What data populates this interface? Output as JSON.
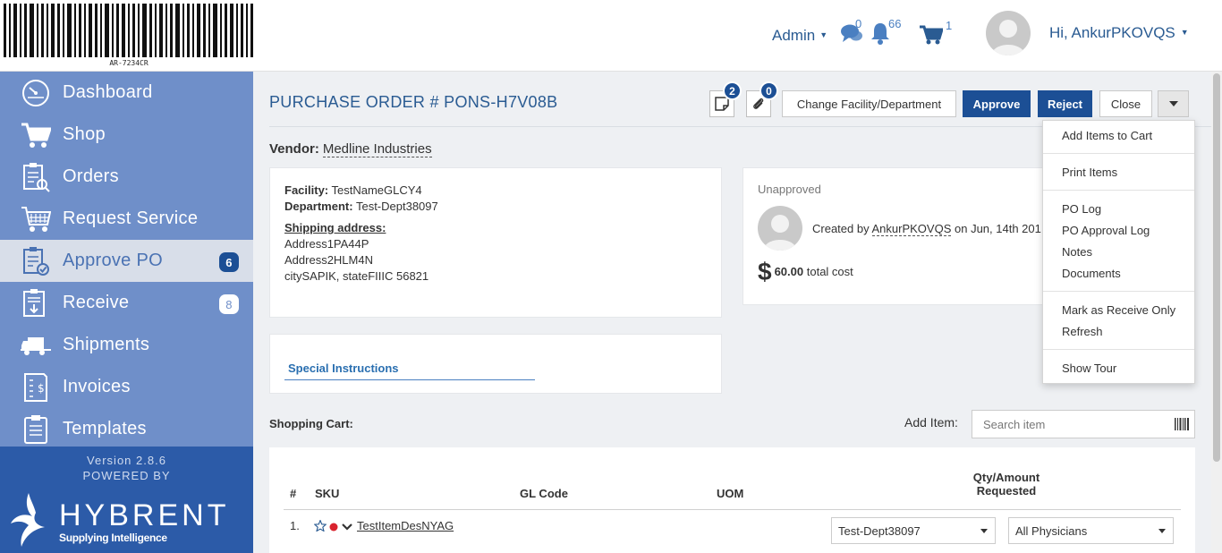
{
  "header": {
    "barcode_text": "AR-7234CR",
    "admin_label": "Admin",
    "messages_count": "0",
    "notifications_count": "66",
    "cart_count": "1",
    "user_greeting": "Hi, AnkurPKOVQS"
  },
  "sidebar": {
    "items": [
      {
        "label": "Dashboard",
        "icon": "dashboard-icon",
        "badge": ""
      },
      {
        "label": "Shop",
        "icon": "cart-icon",
        "badge": ""
      },
      {
        "label": "Orders",
        "icon": "orders-icon",
        "badge": ""
      },
      {
        "label": "Request Service",
        "icon": "request-service-icon",
        "badge": ""
      },
      {
        "label": "Approve PO",
        "icon": "approve-po-icon",
        "badge": "6"
      },
      {
        "label": "Receive",
        "icon": "receive-icon",
        "badge": "8"
      },
      {
        "label": "Shipments",
        "icon": "truck-icon",
        "badge": ""
      },
      {
        "label": "Invoices",
        "icon": "invoice-icon",
        "badge": ""
      },
      {
        "label": "Templates",
        "icon": "template-icon",
        "badge": ""
      }
    ],
    "active_item": "Approve PO",
    "version": "Version 2.8.6",
    "powered_by": "POWERED BY",
    "logo_word": "HYBRENT",
    "logo_tagline": "Supplying Intelligence"
  },
  "po": {
    "title": "PURCHASE ORDER # PONS-H7V08B",
    "notes_count": "2",
    "attachments_count": "0",
    "buttons": {
      "change_facility": "Change Facility/Department",
      "approve": "Approve",
      "reject": "Reject",
      "close": "Close"
    },
    "vendor_label": "Vendor:",
    "vendor_name": "Medline Industries",
    "facility_label": "Facility:",
    "facility": "TestNameGLCY4",
    "department_label": "Department:",
    "department": "Test-Dept38097",
    "shipping_label": "Shipping address:",
    "address_line1": "Address1PA44P",
    "address_line2": "Address2HLM4N",
    "address_line3": "citySAPIK, stateFIIIC 56821",
    "status": "Unapproved",
    "created_prefix": "Created by",
    "created_by": "AnkurPKOVQS",
    "created_suffix": "on Jun, 14th 201",
    "currency_symbol": "$",
    "total": "60.00",
    "total_suffix": "total cost",
    "special_instructions": "Special Instructions"
  },
  "cart": {
    "label": "Shopping Cart:",
    "add_item_label": "Add Item:",
    "search_placeholder": "Search item",
    "columns": {
      "num": "#",
      "sku": "SKU",
      "gl_code": "GL Code",
      "uom": "UOM",
      "qty_line1": "Qty/Amount",
      "qty_line2": "Requested"
    },
    "rows": [
      {
        "num": "1.",
        "sku": "TestItemDesNYAG",
        "department": "Test-Dept38097",
        "physician": "All Physicians"
      }
    ]
  },
  "dropdown_menu": {
    "items": [
      "Add Items to Cart",
      "Print Items",
      "PO Log",
      "PO Approval Log",
      "Notes",
      "Documents",
      "Mark as Receive Only",
      "Refresh",
      "Show Tour"
    ]
  },
  "colors": {
    "brand_dark": "#1c4f95",
    "sidebar": "#6f8fc9",
    "sidebar_footer": "#2c5ba8",
    "link": "#2a5b92"
  }
}
